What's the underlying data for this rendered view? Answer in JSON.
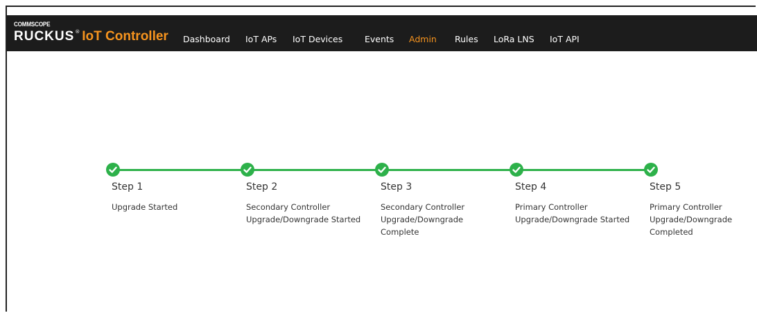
{
  "brand": {
    "company": "COMMSCOPE",
    "name": "RUCKUS",
    "registered": "®",
    "product": "IoT Controller"
  },
  "nav": {
    "items": [
      {
        "label": "Dashboard",
        "active": false
      },
      {
        "label": "IoT APs",
        "active": false
      },
      {
        "label": "IoT Devices",
        "active": false
      },
      {
        "label": "Events",
        "active": false
      },
      {
        "label": "Admin",
        "active": true
      },
      {
        "label": "Rules",
        "active": false
      },
      {
        "label": "LoRa LNS",
        "active": false
      },
      {
        "label": "IoT API",
        "active": false
      }
    ]
  },
  "steps": [
    {
      "title": "Step 1",
      "description": "Upgrade Started",
      "status": "complete"
    },
    {
      "title": "Step 2",
      "description": "Secondary Controller\nUpgrade/Downgrade Started",
      "status": "complete"
    },
    {
      "title": "Step 3",
      "description": "Secondary Controller\nUpgrade/Downgrade\nComplete",
      "status": "complete"
    },
    {
      "title": "Step 4",
      "description": "Primary Controller\nUpgrade/Downgrade Started",
      "status": "complete"
    },
    {
      "title": "Step 5",
      "description": "Primary Controller\nUpgrade/Downgrade\nCompleted",
      "status": "complete"
    }
  ],
  "colors": {
    "topbar": "#1c1c1c",
    "accent": "#f7941e",
    "success": "#2db14a"
  }
}
